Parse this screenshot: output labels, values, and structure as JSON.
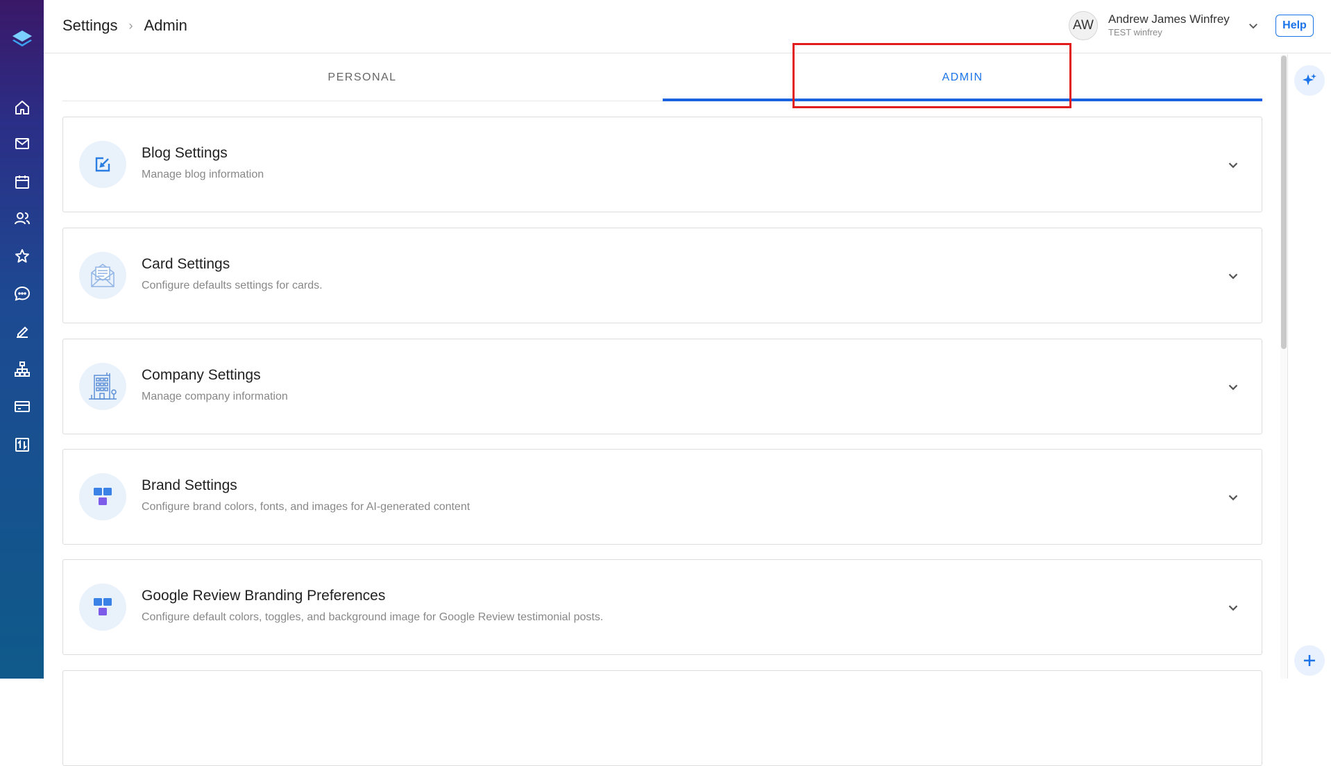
{
  "breadcrumb": {
    "root": "Settings",
    "current": "Admin"
  },
  "user": {
    "initials": "AW",
    "name": "Andrew James Winfrey",
    "subtitle": "TEST winfrey"
  },
  "help_label": "Help",
  "tabs": [
    {
      "label": "PERSONAL",
      "active": false
    },
    {
      "label": "ADMIN",
      "active": true
    }
  ],
  "cards": [
    {
      "title": "Blog Settings",
      "description": "Manage blog information",
      "icon": "edit-square-icon"
    },
    {
      "title": "Card Settings",
      "description": "Configure defaults settings for cards.",
      "icon": "envelope-letter-icon"
    },
    {
      "title": "Company Settings",
      "description": "Manage company information",
      "icon": "building-icon"
    },
    {
      "title": "Brand Settings",
      "description": "Configure brand colors, fonts, and images for AI-generated content",
      "icon": "brand-blocks-icon"
    },
    {
      "title": "Google Review Branding Preferences",
      "description": "Configure default colors, toggles, and background image for Google Review testimonial posts.",
      "icon": "brand-blocks-icon"
    }
  ],
  "sidenav": [
    "home-icon",
    "mail-icon",
    "calendar-icon",
    "contacts-icon",
    "star-icon",
    "chat-icon",
    "edit-icon",
    "org-chart-icon",
    "card-icon",
    "transfer-icon"
  ],
  "colors": {
    "accent": "#1a73e8",
    "highlight": "#e01b1b",
    "nav_top": "#3a1868",
    "nav_bottom": "#0f5a8a"
  }
}
